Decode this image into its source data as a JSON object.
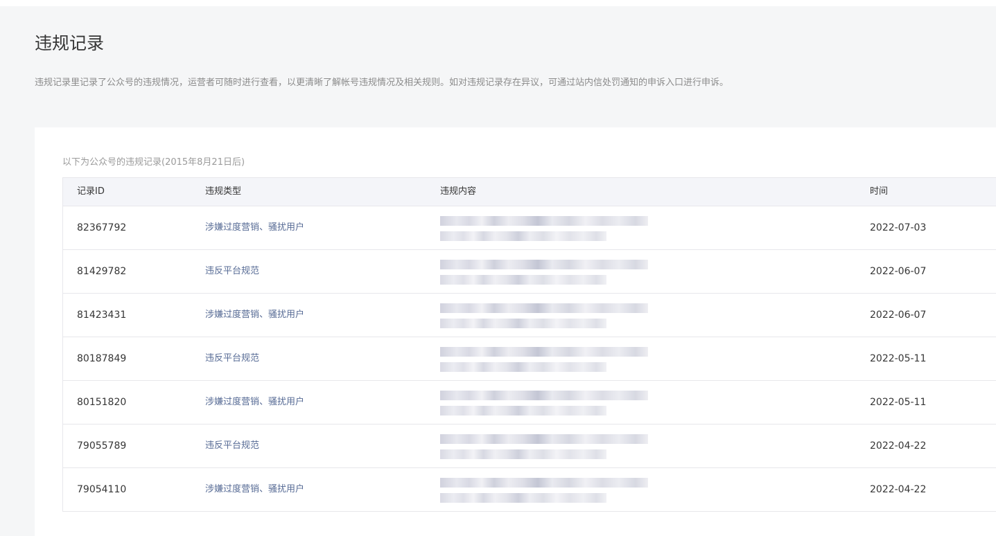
{
  "page": {
    "title": "违规记录",
    "description": "违规记录里记录了公众号的违规情况，运营者可随时进行查看，以更清晰了解帐号违规情况及相关规则。如对违规记录存在异议，可通过站内信处罚通知的申诉入口进行申诉。"
  },
  "table": {
    "caption": "以下为公众号的违规记录(2015年8月21日后)",
    "headers": {
      "id": "记录ID",
      "type": "违规类型",
      "content": "违规内容",
      "time": "时间"
    },
    "rows": [
      {
        "id": "82367792",
        "type": "涉嫌过度营销、骚扰用户",
        "time": "2022-07-03"
      },
      {
        "id": "81429782",
        "type": "违反平台规范",
        "time": "2022-06-07"
      },
      {
        "id": "81423431",
        "type": "涉嫌过度营销、骚扰用户",
        "time": "2022-06-07"
      },
      {
        "id": "80187849",
        "type": "违反平台规范",
        "time": "2022-05-11"
      },
      {
        "id": "80151820",
        "type": "涉嫌过度营销、骚扰用户",
        "time": "2022-05-11"
      },
      {
        "id": "79055789",
        "type": "违反平台规范",
        "time": "2022-04-22"
      },
      {
        "id": "79054110",
        "type": "涉嫌过度营销、骚扰用户",
        "time": "2022-04-22"
      }
    ]
  },
  "colors": {
    "link": "#576b95",
    "header_bg": "#f4f5f9",
    "page_bg": "#f5f6f7"
  }
}
